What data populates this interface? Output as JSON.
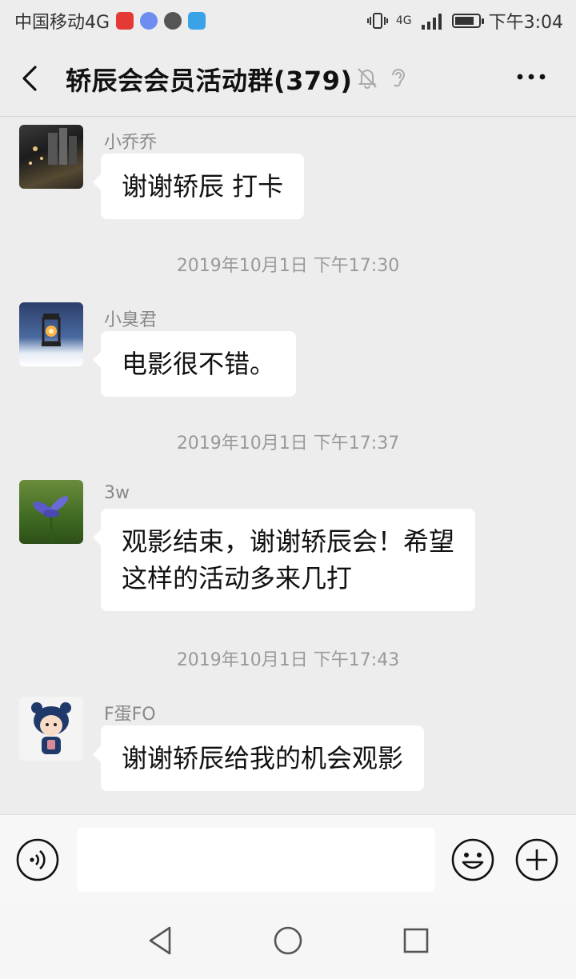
{
  "status_bar": {
    "carrier": "中国移动4G",
    "time": "下午3:04",
    "network": "4G",
    "battery_level": 0.85
  },
  "header": {
    "title": "轿辰会会员活动群(379)"
  },
  "messages": [
    {
      "sender": "小乔乔",
      "text": "谢谢轿辰 打卡"
    },
    {
      "sender": "小臭君",
      "text": "电影很不错。"
    },
    {
      "sender": "3w",
      "text": "观影结束，谢谢轿辰会！希望\n这样的活动多来几打"
    },
    {
      "sender": "F蛋FO",
      "text": "谢谢轿辰给我的机会观影"
    }
  ],
  "timestamps": [
    "2019年10月1日 下午17:30",
    "2019年10月1日 下午17:37",
    "2019年10月1日 下午17:43"
  ],
  "input": {
    "value": "",
    "placeholder": ""
  },
  "icons": {
    "back": "back-arrow-icon",
    "mute": "mute-bell-icon",
    "ear": "earpiece-icon",
    "more": "more-dots-icon",
    "voice": "voice-input-icon",
    "emoji": "emoji-icon",
    "plus": "plus-icon"
  },
  "colors": {
    "background": "#ededed",
    "bubble": "#ffffff",
    "timestamp": "#999999"
  }
}
